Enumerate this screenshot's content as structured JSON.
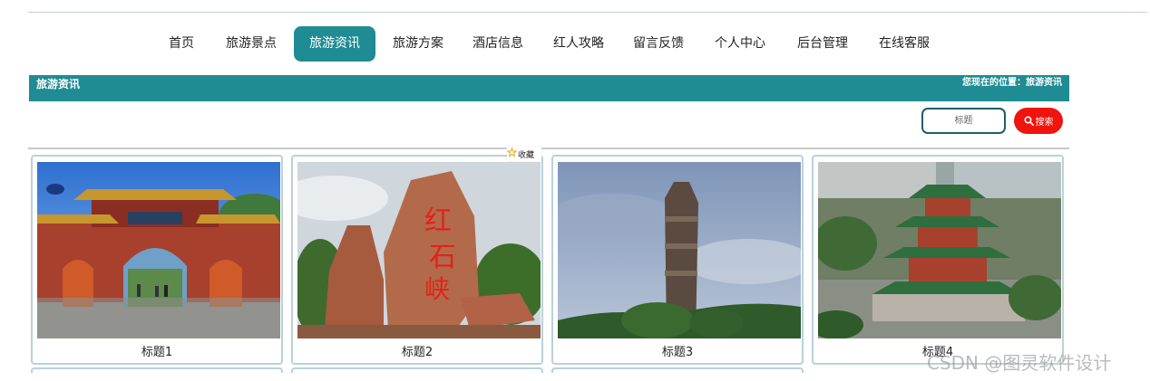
{
  "nav": {
    "items": [
      {
        "label": "首页",
        "active": false
      },
      {
        "label": "旅游景点",
        "active": false
      },
      {
        "label": "旅游资讯",
        "active": true
      },
      {
        "label": "旅游方案",
        "active": false
      },
      {
        "label": "酒店信息",
        "active": false
      },
      {
        "label": "红人攻略",
        "active": false
      },
      {
        "label": "留言反馈",
        "active": false
      },
      {
        "label": "个人中心",
        "active": false
      },
      {
        "label": "后台管理",
        "active": false
      },
      {
        "label": "在线客服",
        "active": false
      }
    ]
  },
  "banner": {
    "title": "旅游资讯",
    "location": "您现在的位置：旅游资讯"
  },
  "search": {
    "placeholder": "标题",
    "button_label": "搜索"
  },
  "favorite": {
    "label": "收藏"
  },
  "cards": [
    {
      "caption": "标题1",
      "image": "chinese-gate-photo"
    },
    {
      "caption": "标题2",
      "image": "red-rock-monument-photo"
    },
    {
      "caption": "标题3",
      "image": "rock-pillar-photo"
    },
    {
      "caption": "标题4",
      "image": "pavilion-tower-photo"
    }
  ],
  "watermark": "CSDN @图灵软件设计",
  "colors": {
    "accent": "#1f8c93",
    "search_button": "#f0140e",
    "card_border": "#b9d1db"
  }
}
